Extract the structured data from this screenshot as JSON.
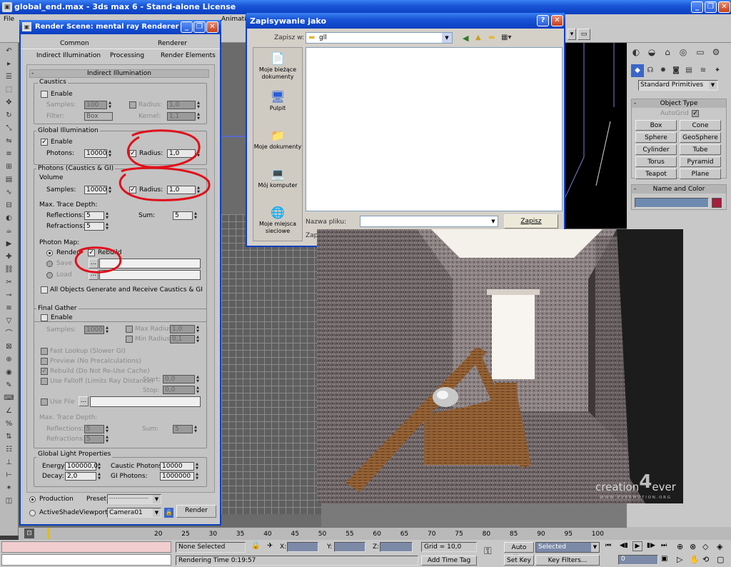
{
  "app": {
    "title": "global_end.max - 3ds max 6 - Stand-alone License",
    "menu": [
      "File",
      "Animation"
    ]
  },
  "render": {
    "title": "Render Scene: mental ray Renderer",
    "tabs_row1": [
      "Common",
      "Renderer"
    ],
    "tabs_row2": [
      "Indirect Illumination",
      "Processing",
      "Render Elements"
    ],
    "rollout": "Indirect Illumination",
    "caustics": {
      "title": "Caustics",
      "enable": "Enable",
      "samples_label": "Samples:",
      "samples": "100",
      "radius_label": "Radius:",
      "radius": "1,0",
      "filter_label": "Filter:",
      "filter": "Box",
      "kernel_label": "Kernel:",
      "kernel": "1,1"
    },
    "gi": {
      "title": "Global Illumination",
      "enable": "Enable",
      "photons_label": "Photons:",
      "photons": "10000",
      "radius_label": "Radius:",
      "radius": "1,0"
    },
    "volume": {
      "title": "Photons (Caustics & GI)",
      "sub": "Volume",
      "samples_label": "Samples:",
      "samples": "10000",
      "radius_label": "Radius:",
      "radius": "1,0"
    },
    "trace": {
      "title": "Max. Trace Depth:",
      "reflections_label": "Reflections:",
      "reflections": "5",
      "refractions_label": "Refractions:",
      "refractions": "5",
      "sum_label": "Sum:",
      "sum": "5"
    },
    "photonmap": {
      "title": "Photon Map:",
      "render": "Render",
      "rebuild": "Rebuild",
      "save": "Save",
      "load": "Load",
      "browse": "...",
      "all_objects": "All Objects Generate and Receive Caustics & GI"
    },
    "fg": {
      "title": "Final Gather",
      "enable": "Enable",
      "samples_label": "Samples:",
      "samples": "1000",
      "max_radius_label": "Max Radius:",
      "max_radius": "1,0",
      "min_radius_label": "Min Radius:",
      "min_radius": "0,1",
      "fast_lookup": "Fast Lookup (Slower GI)",
      "preview": "Preview (No Precalculations)",
      "rebuild": "Rebuild (Do Not Re-Use Cache)",
      "use_falloff": "Use Falloff (Limits Ray Distance)",
      "start_label": "Start:",
      "start": "0,0",
      "stop_label": "Stop:",
      "stop": "0,0",
      "use_file": "Use File",
      "browse": "...",
      "trace_title": "Max. Trace Depth:",
      "reflections_label": "Reflections:",
      "reflections": "5",
      "refractions_label": "Refractions:",
      "refractions": "5",
      "sum_label": "Sum:",
      "sum": "5"
    },
    "glp": {
      "title": "Global Light Properties",
      "energy_label": "Energy:",
      "energy": "100000,0",
      "caustic_label": "Caustic Photons:",
      "caustic": "10000",
      "decay_label": "Decay:",
      "decay": "2,0",
      "gi_photons_label": "GI Photons:",
      "gi_photons": "1000000"
    },
    "bottom": {
      "production": "Production",
      "activeshade": "ActiveShade",
      "preset_label": "Preset:",
      "preset": "-------------------",
      "viewport_label": "Viewport:",
      "viewport": "Camera01",
      "render": "Render"
    }
  },
  "save": {
    "title": "Zapisywanie jako",
    "save_in_label": "Zapisz w:",
    "folder": "gll",
    "places": [
      "Moje bieżące dokumenty",
      "Pulpit",
      "Moje dokumenty",
      "Mój komputer",
      "Moje miejsca sieciowe"
    ],
    "filename_label": "Nazwa pliku:",
    "filetype_label": "Zap",
    "save_button": "Zapisz"
  },
  "cmd": {
    "dropdown": "Standard Primitives",
    "object_type": "Object Type",
    "autogrid": "AutoGrid",
    "buttons": [
      "Box",
      "Cone",
      "Sphere",
      "GeoSphere",
      "Cylinder",
      "Tube",
      "Torus",
      "Pyramid",
      "Teapot",
      "Plane"
    ],
    "name_color": "Name and Color"
  },
  "timeline": {
    "ticks": [
      "20",
      "25",
      "30",
      "35",
      "40",
      "45",
      "50",
      "55",
      "60",
      "65",
      "70",
      "75",
      "80",
      "85",
      "90",
      "95",
      "100"
    ]
  },
  "status": {
    "none_selected": "None Selected",
    "rendering_time": "Rendering Time  0:19:57",
    "x_label": "X:",
    "y_label": "Y:",
    "z_label": "Z:",
    "grid": "Grid = 10,0",
    "add_time_tag": "Add Time Tag",
    "auto_key": "Auto Key",
    "set_key": "Set Key",
    "selected": "Selected",
    "key_filters": "Key Filters...",
    "frame": "0"
  },
  "render_image": {
    "watermark": "creation",
    "watermark2": "ever",
    "url": "W W W . E V E R M O T I O N . O R G"
  },
  "colors": {
    "xp_blue": "#1a55d8",
    "max_gray": "#c8c8c8",
    "swatch": "#a31f3c"
  }
}
